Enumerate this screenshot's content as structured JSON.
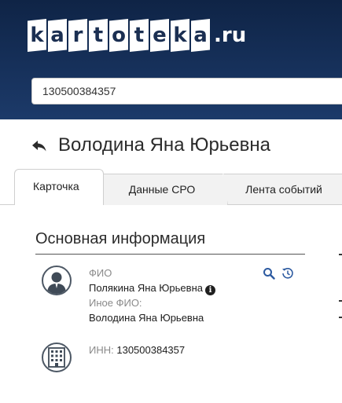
{
  "header": {
    "logo_letters": [
      "k",
      "a",
      "r",
      "t",
      "o",
      "t",
      "e",
      "k",
      "a"
    ],
    "logo_suffix": ".ru",
    "search_value": "130500384357"
  },
  "page": {
    "title": "Володина Яна Юрьевна"
  },
  "tabs": [
    {
      "label": "Карточка",
      "active": true
    },
    {
      "label": "Данные СРО",
      "active": false
    },
    {
      "label": "Лента событий",
      "active": false
    }
  ],
  "main_info": {
    "section_title": "Основная информация",
    "fio_label": "ФИО",
    "fio_value": "Полякина Яна Юрьевна",
    "other_fio_label": "Иное ФИО:",
    "other_fio_value": "Володина Яна Юрьевна",
    "inn_label": "ИНН:",
    "inn_value": "130500384357"
  },
  "colors": {
    "header_bg": "#16305a",
    "icon_blue": "#2c5aa0"
  }
}
